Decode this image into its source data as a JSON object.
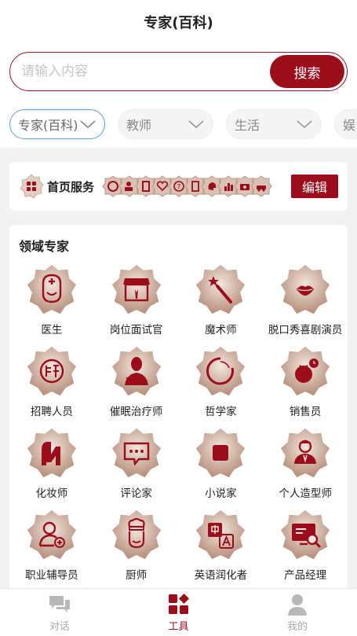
{
  "header": {
    "title": "专家(百科)"
  },
  "search": {
    "placeholder": "请输入内容",
    "button_label": "搜索"
  },
  "filters": [
    {
      "label": "专家(百科)",
      "active": true
    },
    {
      "label": "教师",
      "active": false
    },
    {
      "label": "生活",
      "active": false
    },
    {
      "label": "娱",
      "active": false
    }
  ],
  "services": {
    "label": "首页服务",
    "edit_label": "编辑",
    "icons": [
      "doctor-icon",
      "user-plus-icon",
      "building-icon",
      "heart-icon",
      "help-icon",
      "document-icon",
      "brain-icon",
      "chart-icon",
      "camera-icon",
      "car-icon"
    ]
  },
  "experts": {
    "heading": "领域专家",
    "items": [
      {
        "name": "医生",
        "icon": "doctor-icon"
      },
      {
        "name": "岗位面试官",
        "icon": "storefront-icon"
      },
      {
        "name": "魔术师",
        "icon": "magic-wand-icon"
      },
      {
        "name": "脱口秀喜剧演员",
        "icon": "lips-icon"
      },
      {
        "name": "招聘人员",
        "icon": "hire-stamp-icon"
      },
      {
        "name": "催眠治疗师",
        "icon": "person-icon"
      },
      {
        "name": "哲学家",
        "icon": "circle-icon"
      },
      {
        "name": "销售员",
        "icon": "tomato-icon"
      },
      {
        "name": "化妆师",
        "icon": "boot-icon"
      },
      {
        "name": "评论家",
        "icon": "comment-icon"
      },
      {
        "name": "小说家",
        "icon": "book-icon"
      },
      {
        "name": "个人造型师",
        "icon": "stylist-icon"
      },
      {
        "name": "职业辅导员",
        "icon": "counselor-icon"
      },
      {
        "name": "厨师",
        "icon": "chef-icon"
      },
      {
        "name": "英语润化者",
        "icon": "translate-icon"
      },
      {
        "name": "产品经理",
        "icon": "monitor-search-icon"
      }
    ]
  },
  "tabbar": [
    {
      "label": "对话",
      "icon": "chat-icon",
      "active": false
    },
    {
      "label": "工具",
      "icon": "tools-grid-icon",
      "active": true
    },
    {
      "label": "我的",
      "icon": "profile-icon",
      "active": false
    }
  ],
  "colors": {
    "accent": "#9c0d1c",
    "badge_light": "#e8d6cc",
    "badge_dark": "#b48c78",
    "tab_inactive": "#aaaaaa",
    "active_chip_border": "#5aa0e0"
  }
}
